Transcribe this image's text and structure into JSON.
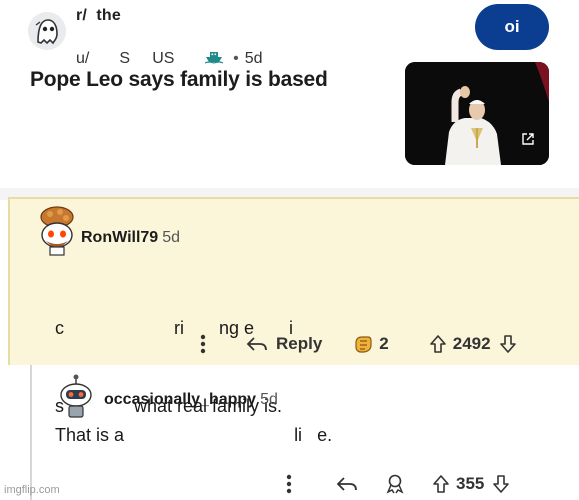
{
  "post": {
    "subreddit": "r/  the",
    "author_prefix": "u/",
    "author_name": "S     US",
    "time_ago": "5d",
    "join_button": "oi",
    "title": "Pope Leo says family is based",
    "thumbnail_icon": "external-link-icon"
  },
  "comments": [
    {
      "username": "RonWill79",
      "time_ago": "5d",
      "body_line1": "c                      ri       ng e       i",
      "body_line2": "s              what real family is.",
      "reply_label": "Reply",
      "award_count": "2",
      "score": "2492"
    },
    {
      "username": "occasionally_happy",
      "time_ago": "5d",
      "body": "That is a                                  li   e.",
      "score": "355"
    }
  ],
  "watermark": "imgflip.com",
  "colors": {
    "join_button": "#0b3d91",
    "highlight_bg": "#fbf5da",
    "highlight_border": "#e6dca5"
  }
}
